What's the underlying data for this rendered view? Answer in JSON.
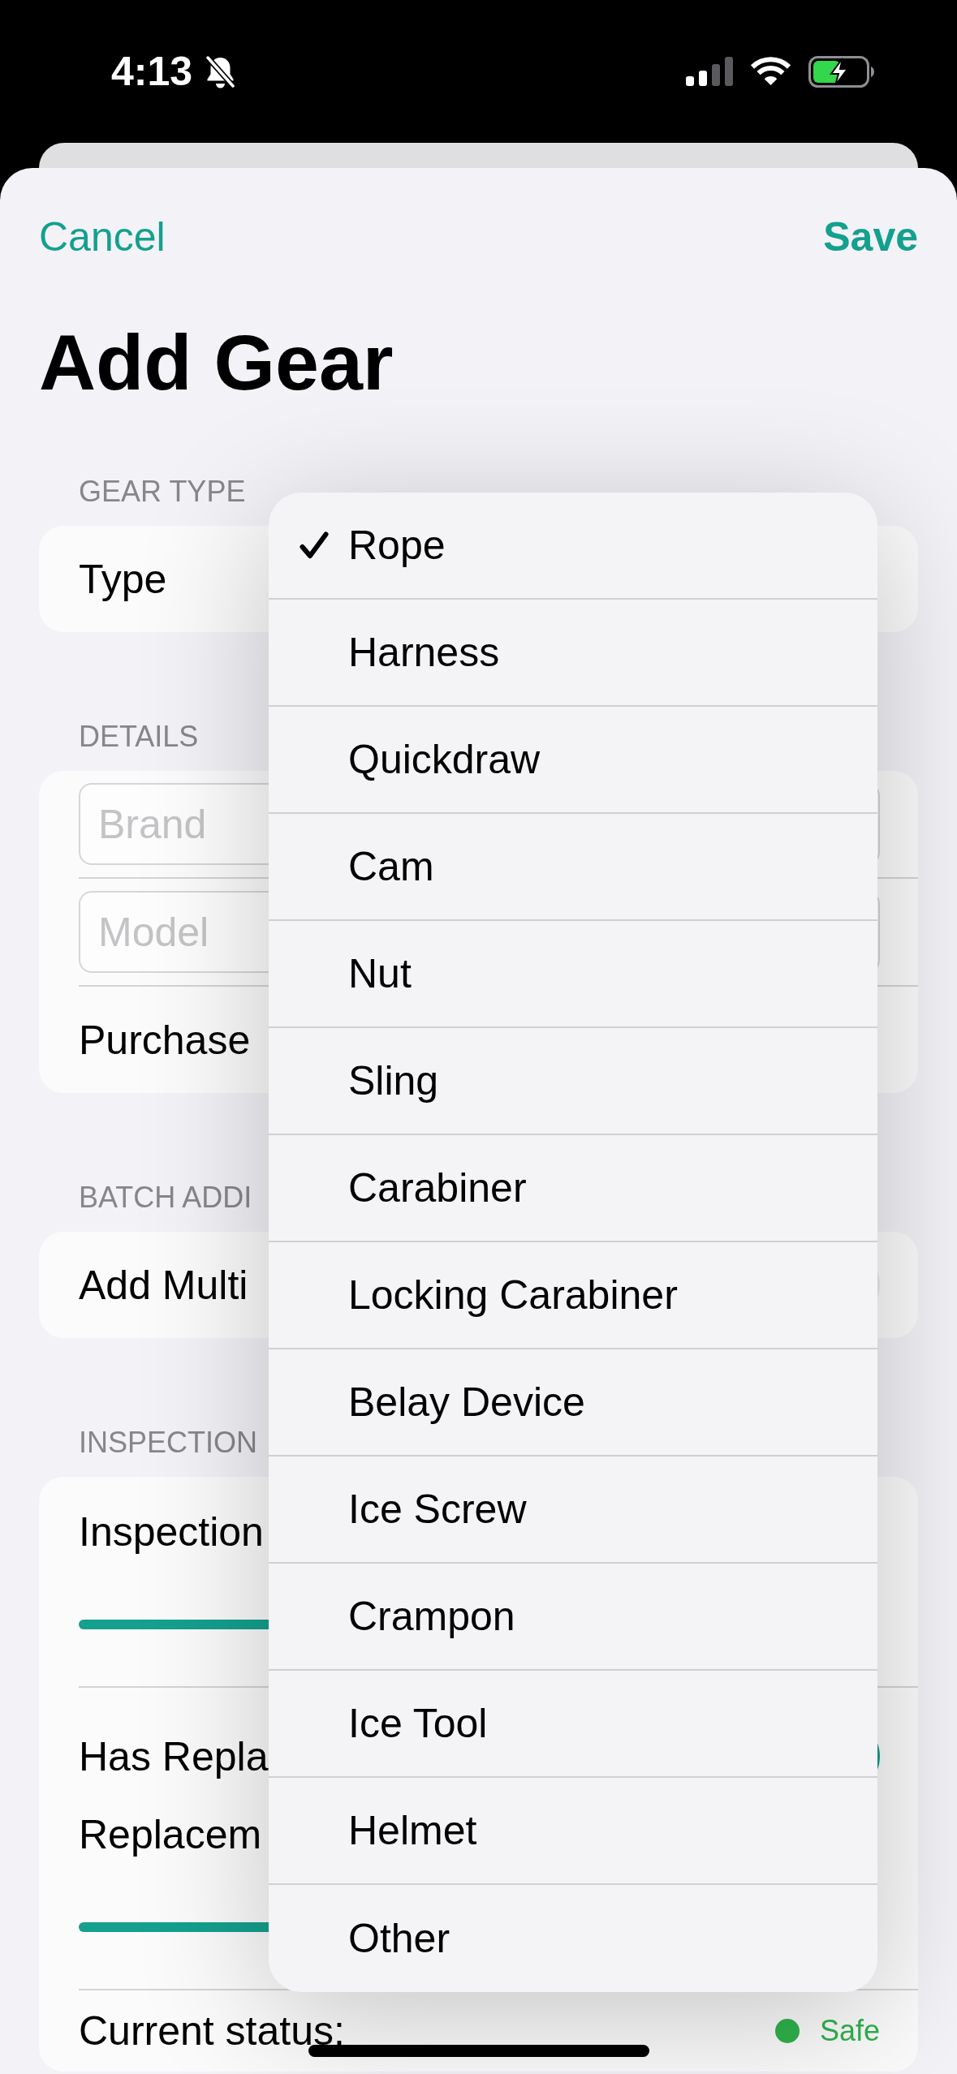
{
  "status_bar": {
    "time": "4:13"
  },
  "nav": {
    "cancel": "Cancel",
    "save": "Save"
  },
  "title": "Add Gear",
  "sections": [
    {
      "header": "GEAR TYPE",
      "groups": [
        {
          "rows": [
            {
              "kind": "label",
              "label": "Type"
            }
          ]
        }
      ]
    },
    {
      "header": "DETAILS",
      "groups": [
        {
          "rows": [
            {
              "kind": "field",
              "placeholder": "Brand"
            }
          ]
        },
        {
          "rows": [
            {
              "kind": "field",
              "placeholder": "Model"
            }
          ]
        },
        {
          "rows": [
            {
              "kind": "label",
              "label": "Purchase"
            }
          ]
        }
      ]
    },
    {
      "header": "BATCH ADDI",
      "groups": [
        {
          "rows": [
            {
              "kind": "toggle",
              "label": "Add Multi",
              "on": false
            }
          ]
        }
      ]
    },
    {
      "header": "INSPECTION",
      "groups": [
        {
          "rows": [
            {
              "kind": "label",
              "label": "Inspection"
            },
            {
              "kind": "slider"
            }
          ]
        },
        {
          "rows": [
            {
              "kind": "toggle",
              "label": "Has Repla",
              "on": true
            },
            {
              "kind": "label",
              "label": "Replacem"
            },
            {
              "kind": "slider"
            }
          ]
        },
        {
          "rows": [
            {
              "kind": "status",
              "label": "Current status:",
              "value": "Safe",
              "color": "#2fb34c"
            }
          ]
        }
      ]
    }
  ],
  "type_menu": {
    "items": [
      {
        "label": "Rope",
        "selected": true
      },
      {
        "label": "Harness",
        "selected": false
      },
      {
        "label": "Quickdraw",
        "selected": false
      },
      {
        "label": "Cam",
        "selected": false
      },
      {
        "label": "Nut",
        "selected": false
      },
      {
        "label": "Sling",
        "selected": false
      },
      {
        "label": "Carabiner",
        "selected": false
      },
      {
        "label": "Locking Carabiner",
        "selected": false
      },
      {
        "label": "Belay Device",
        "selected": false
      },
      {
        "label": "Ice Screw",
        "selected": false
      },
      {
        "label": "Crampon",
        "selected": false
      },
      {
        "label": "Ice Tool",
        "selected": false
      },
      {
        "label": "Helmet",
        "selected": false
      },
      {
        "label": "Other",
        "selected": false
      }
    ]
  }
}
